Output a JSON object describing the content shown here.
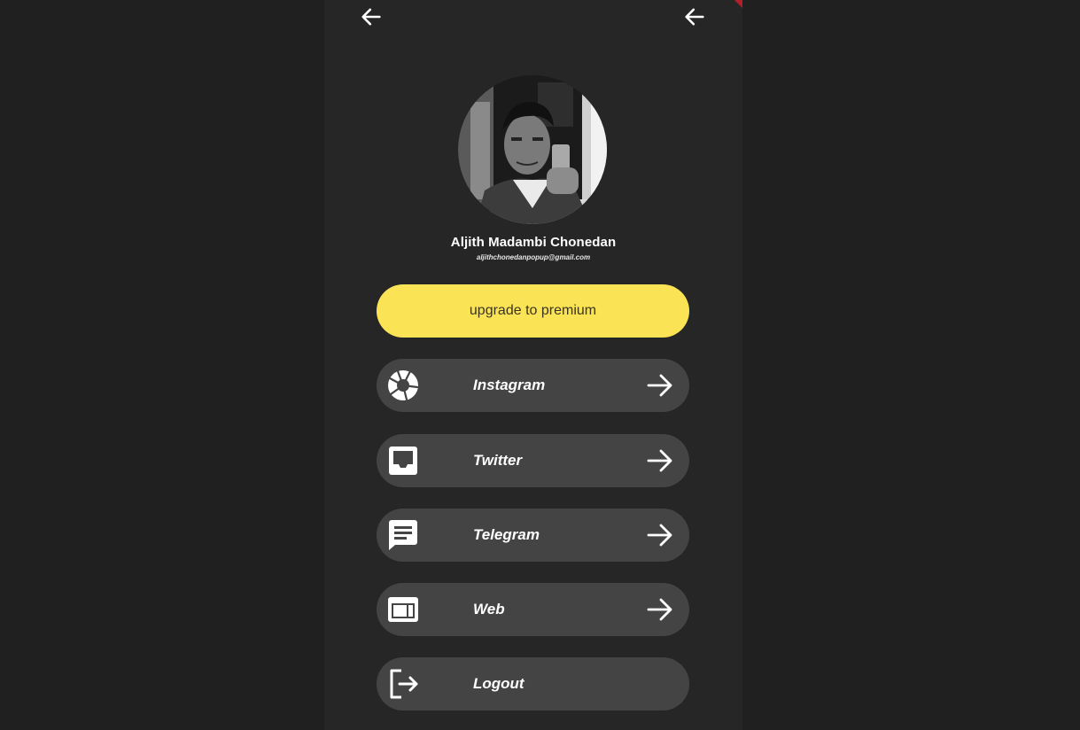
{
  "header": {
    "back_left_icon": "arrow-left-icon",
    "back_right_icon": "arrow-left-icon"
  },
  "profile": {
    "name": "Aljith Madambi Chonedan",
    "email": "aljithchonedanpopup@gmail.com",
    "avatar_icon": "profile-photo"
  },
  "premium": {
    "label": "upgrade to premium",
    "color": "#fbe356"
  },
  "menu": [
    {
      "label": "Instagram",
      "icon": "camera-aperture-icon",
      "has_arrow": true
    },
    {
      "label": "Twitter",
      "icon": "inbox-tray-icon",
      "has_arrow": true
    },
    {
      "label": "Telegram",
      "icon": "chat-bubble-icon",
      "has_arrow": true
    },
    {
      "label": "Web",
      "icon": "web-window-icon",
      "has_arrow": true
    },
    {
      "label": "Logout",
      "icon": "logout-icon",
      "has_arrow": false
    }
  ],
  "colors": {
    "background": "#202020",
    "screen": "#262626",
    "menu_item": "#444444",
    "accent": "#fbe356"
  }
}
